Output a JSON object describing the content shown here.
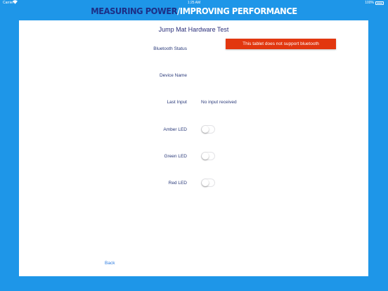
{
  "status_bar": {
    "carrier": "Carrier",
    "wifi_icon": "wifi-icon",
    "time": "1:25 AM",
    "battery_percent": "100%",
    "battery_icon": "battery-icon"
  },
  "brand": {
    "part1": "MEASURING POWER",
    "part2": "/IMPROVING PERFORMANCE"
  },
  "card": {
    "title": "Jump Mat Hardware Test",
    "rows": [
      {
        "label": "Bluetooth Status",
        "value": ""
      },
      {
        "label": "Device Name",
        "value": ""
      },
      {
        "label": "Last Input",
        "value": "No input received"
      }
    ],
    "toggles": [
      {
        "label": "Amber LED",
        "on": false
      },
      {
        "label": "Green LED",
        "on": false
      },
      {
        "label": "Red LED",
        "on": false
      }
    ],
    "alert": "This tablet does not support bluetooth",
    "back_label": "Back"
  },
  "colors": {
    "background": "#1e96e8",
    "brand_dark": "#1c2f86",
    "alert": "#e2370f",
    "link": "#2f7de0"
  }
}
